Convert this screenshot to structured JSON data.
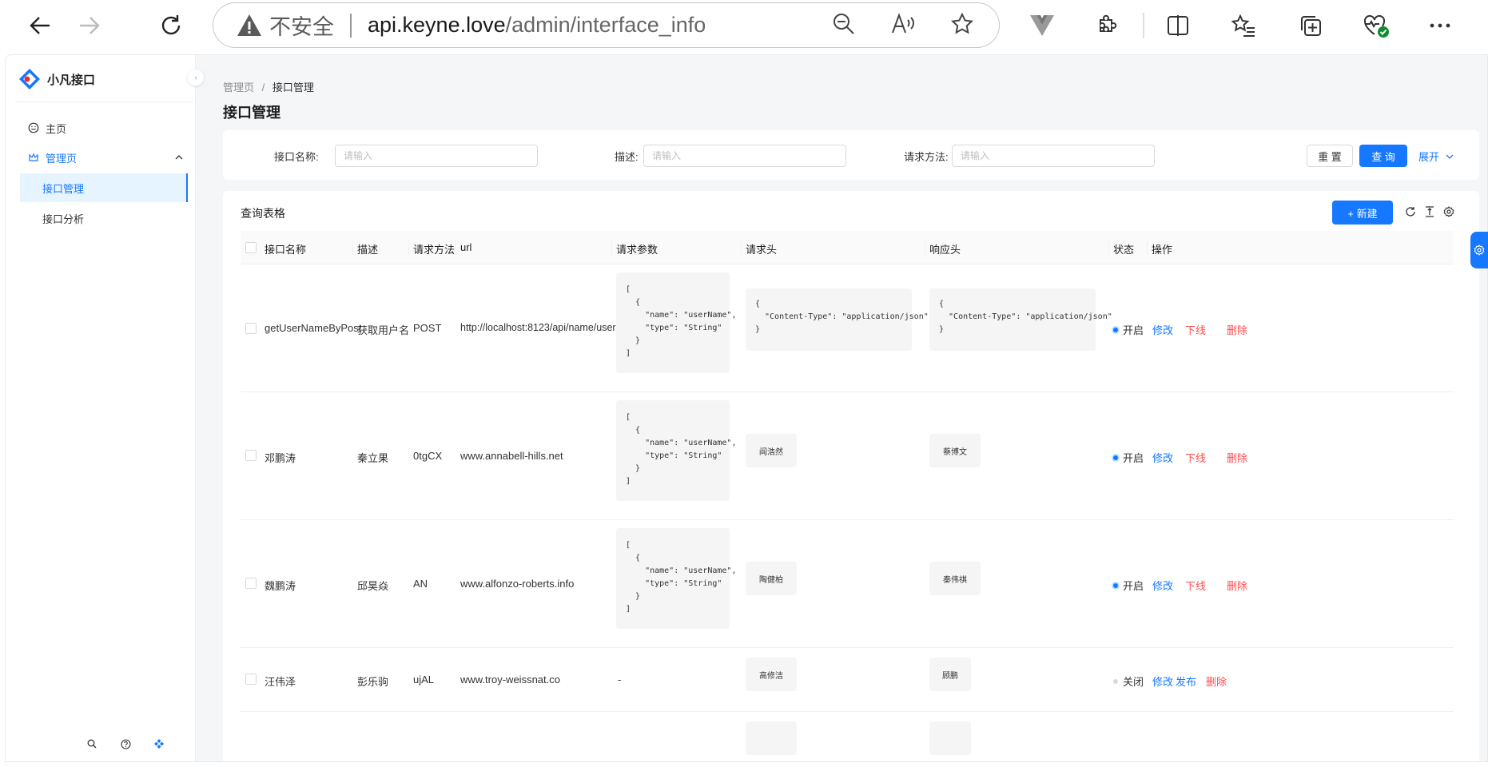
{
  "browser": {
    "insecure_label": "不安全",
    "url_host": "api.keyne.love",
    "url_path": "/admin/interface_info"
  },
  "sidebar": {
    "app_name": "小凡接口",
    "items": [
      {
        "label": "主页"
      },
      {
        "label": "管理页"
      }
    ],
    "sub_items": [
      {
        "label": "接口管理"
      },
      {
        "label": "接口分析"
      }
    ]
  },
  "breadcrumb": {
    "root": "管理页",
    "separator": "/",
    "current": "接口管理"
  },
  "page": {
    "title": "接口管理"
  },
  "search": {
    "fields": [
      {
        "label": "接口名称:",
        "placeholder": "请输入"
      },
      {
        "label": "描述:",
        "placeholder": "请输入"
      },
      {
        "label": "请求方法:",
        "placeholder": "请输入"
      }
    ],
    "reset_label": "重 置",
    "query_label": "查 询",
    "expand_label": "展开"
  },
  "table": {
    "title": "查询表格",
    "new_label": "+ 新建",
    "columns": [
      "接口名称",
      "描述",
      "请求方法",
      "url",
      "请求参数",
      "请求头",
      "响应头",
      "状态",
      "操作"
    ],
    "rows": [
      {
        "name": "getUserNameByPost",
        "desc": "获取用户名",
        "method": "POST",
        "url": "http://localhost:8123/api/name/user",
        "params": "[\n  {\n    \"name\": \"userName\",\n    \"type\": \"String\"\n  }\n]",
        "req_header": "{\n  \"Content-Type\": \"application/json\"\n}",
        "res_header": "{\n  \"Content-Type\": \"application/json\"\n}",
        "status": "开启",
        "actions": [
          "修改",
          "下线",
          "删除"
        ]
      },
      {
        "name": "邓鹏涛",
        "desc": "秦立果",
        "method": "0tgCX",
        "url": "www.annabell-hills.net",
        "params": "[\n  {\n    \"name\": \"userName\",\n    \"type\": \"String\"\n  }\n]",
        "req_header": "阎浩然",
        "res_header": "蔡博文",
        "status": "开启",
        "actions": [
          "修改",
          "下线",
          "删除"
        ]
      },
      {
        "name": "魏鹏涛",
        "desc": "邱昊焱",
        "method": "AN",
        "url": "www.alfonzo-roberts.info",
        "params": "[\n  {\n    \"name\": \"userName\",\n    \"type\": \"String\"\n  }\n]",
        "req_header": "陶健柏",
        "res_header": "秦伟祺",
        "status": "开启",
        "actions": [
          "修改",
          "下线",
          "删除"
        ]
      },
      {
        "name": "汪伟泽",
        "desc": "彭乐驹",
        "method": "ujAL",
        "url": "www.troy-weissnat.co",
        "params": "-",
        "req_header": "高修洁",
        "res_header": "顾鹏",
        "status": "关闭",
        "actions": [
          "修改",
          "发布",
          "删除"
        ]
      }
    ]
  },
  "colors": {
    "primary": "#1677ff",
    "danger": "#ff4d4f",
    "status_on": "#1677ff",
    "status_off": "#d9d9d9"
  }
}
